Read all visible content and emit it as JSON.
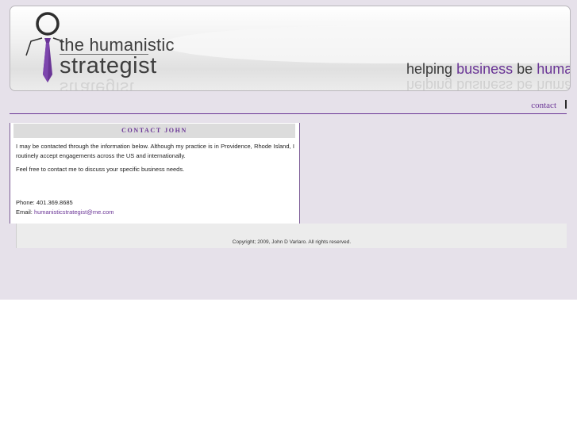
{
  "header": {
    "logo": {
      "line1": "the humanistic",
      "line2": "strategist"
    },
    "tagline": {
      "word1": "helping",
      "word2": "business",
      "word3": "be",
      "word4": "human"
    }
  },
  "nav": {
    "contact_label": "contact"
  },
  "content": {
    "title": "CONTACT JOHN",
    "paragraph1": "I may be contacted through the information below. Although my practice is in Providence, Rhode Island, I routinely accept engagements across the US and internationally.",
    "paragraph2": "Feel free to contact me to discuss your specific business needs.",
    "phone": "Phone: 401.369.8685",
    "email_label": "Email:",
    "email": "humanisticstrategist@me.com"
  },
  "footer": {
    "copyright": "Copyright; 2009, John D Varlaro. All rights reserved."
  },
  "colors": {
    "accent": "#6a3596",
    "page_bg": "#e6e1ea"
  }
}
